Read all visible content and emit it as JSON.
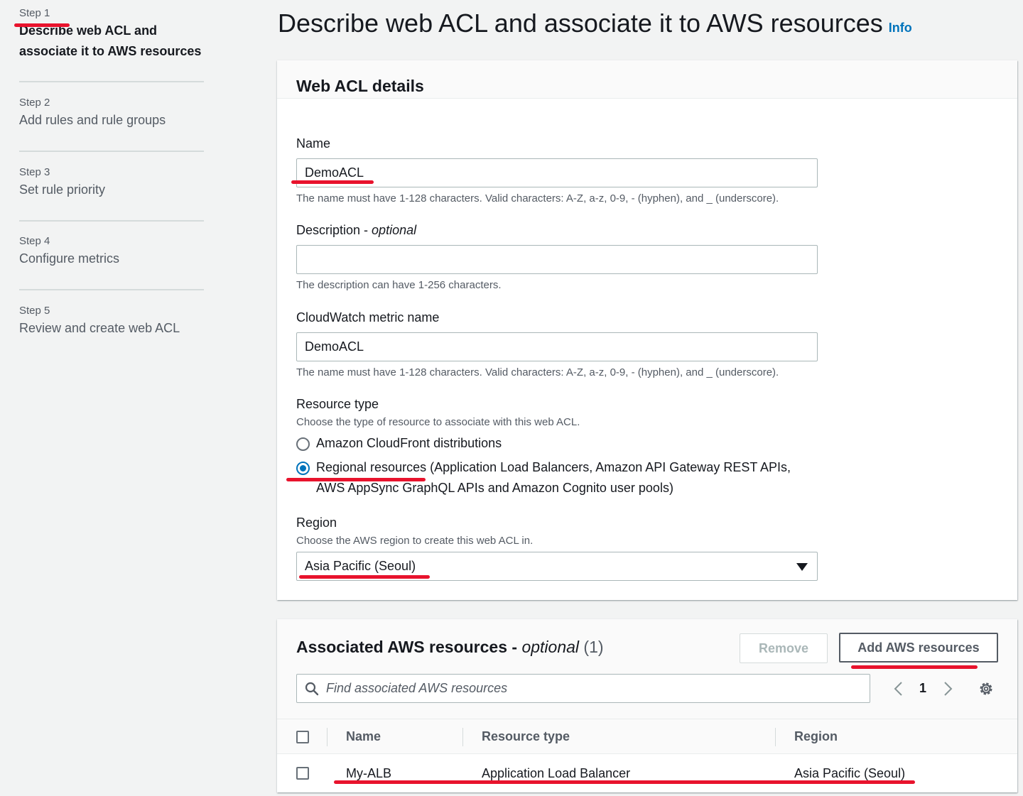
{
  "sidebar": {
    "steps": [
      {
        "label": "Step 1",
        "title": "Describe web ACL and associate it to AWS resources"
      },
      {
        "label": "Step 2",
        "title": "Add rules and rule groups"
      },
      {
        "label": "Step 3",
        "title": "Set rule priority"
      },
      {
        "label": "Step 4",
        "title": "Configure metrics"
      },
      {
        "label": "Step 5",
        "title": "Review and create web ACL"
      }
    ]
  },
  "page": {
    "title": "Describe web ACL and associate it to AWS resources",
    "info": "Info"
  },
  "details": {
    "title": "Web ACL details",
    "name_label": "Name",
    "name_value": "DemoACL",
    "name_hint": "The name must have 1-128 characters. Valid characters: A-Z, a-z, 0-9, - (hyphen), and _ (underscore).",
    "desc_label": "Description",
    "desc_optional": "optional",
    "desc_value": "",
    "desc_hint": "The description can have 1-256 characters.",
    "metric_label": "CloudWatch metric name",
    "metric_value": "DemoACL",
    "metric_hint": "The name must have 1-128 characters. Valid characters: A-Z, a-z, 0-9, - (hyphen), and _ (underscore).",
    "resource_type_label": "Resource type",
    "resource_type_hint": "Choose the type of resource to associate with this web ACL.",
    "resource_options": [
      {
        "label": "Amazon CloudFront distributions",
        "selected": false
      },
      {
        "label": "Regional resources (Application Load Balancers, Amazon API Gateway REST APIs,",
        "label2": "AWS AppSync GraphQL APIs and Amazon Cognito user pools)",
        "selected": true
      }
    ],
    "region_label": "Region",
    "region_hint": "Choose the AWS region to create this web ACL in.",
    "region_value": "Asia Pacific (Seoul)"
  },
  "associated": {
    "title": "Associated AWS resources",
    "optional": "optional",
    "count": "(1)",
    "remove_button": "Remove",
    "add_button": "Add AWS resources",
    "search_placeholder": "Find associated AWS resources",
    "page_number": "1",
    "columns": [
      "Name",
      "Resource type",
      "Region"
    ],
    "rows": [
      {
        "name": "My-ALB",
        "type": "Application Load Balancer",
        "region": "Asia Pacific (Seoul)"
      }
    ]
  },
  "colors": {
    "accent": "#0073bb",
    "annotation": "#e8132d",
    "background": "#f2f3f3"
  }
}
